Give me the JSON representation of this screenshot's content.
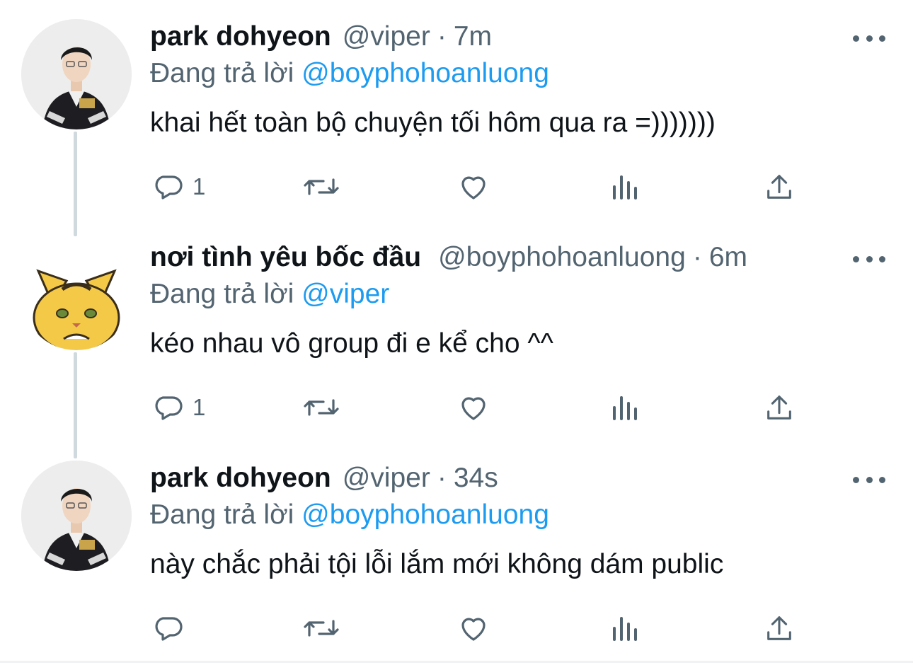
{
  "tweets": [
    {
      "name": "park dohyeon",
      "handle": "@viper",
      "separator": "·",
      "time": "7m",
      "replying_prefix": "Đang trả lời",
      "replying_to": "@boyphohoanluong",
      "text": "khai hết toàn bộ chuyện tối hôm qua ra =)))))))",
      "reply_count": "1",
      "avatar": "player-photo"
    },
    {
      "name": "nơi tình yêu bốc đầu",
      "handle": "@boyphohoanluong",
      "separator": "·",
      "time": "6m",
      "replying_prefix": "Đang trả lời",
      "replying_to": "@viper",
      "text": "kéo nhau vô group đi e kể cho ^^",
      "reply_count": "1",
      "avatar": "tiger-cat-mascot"
    },
    {
      "name": "park dohyeon",
      "handle": "@viper",
      "separator": "·",
      "time": "34s",
      "replying_prefix": "Đang trả lời",
      "replying_to": "@boyphohoanluong",
      "text": "này chắc phải tội lỗi lắm mới không dám public",
      "reply_count": "",
      "avatar": "player-photo"
    }
  ],
  "icons": {
    "reply": "reply-icon",
    "retweet": "retweet-icon",
    "like": "like-icon",
    "analytics": "analytics-icon",
    "share": "share-icon",
    "more": "more-icon"
  },
  "colors": {
    "text": "#0f1419",
    "secondary": "#536471",
    "mention": "#1d9bf0",
    "thread_line": "#cfd9de",
    "mascot": "#f5c948"
  }
}
